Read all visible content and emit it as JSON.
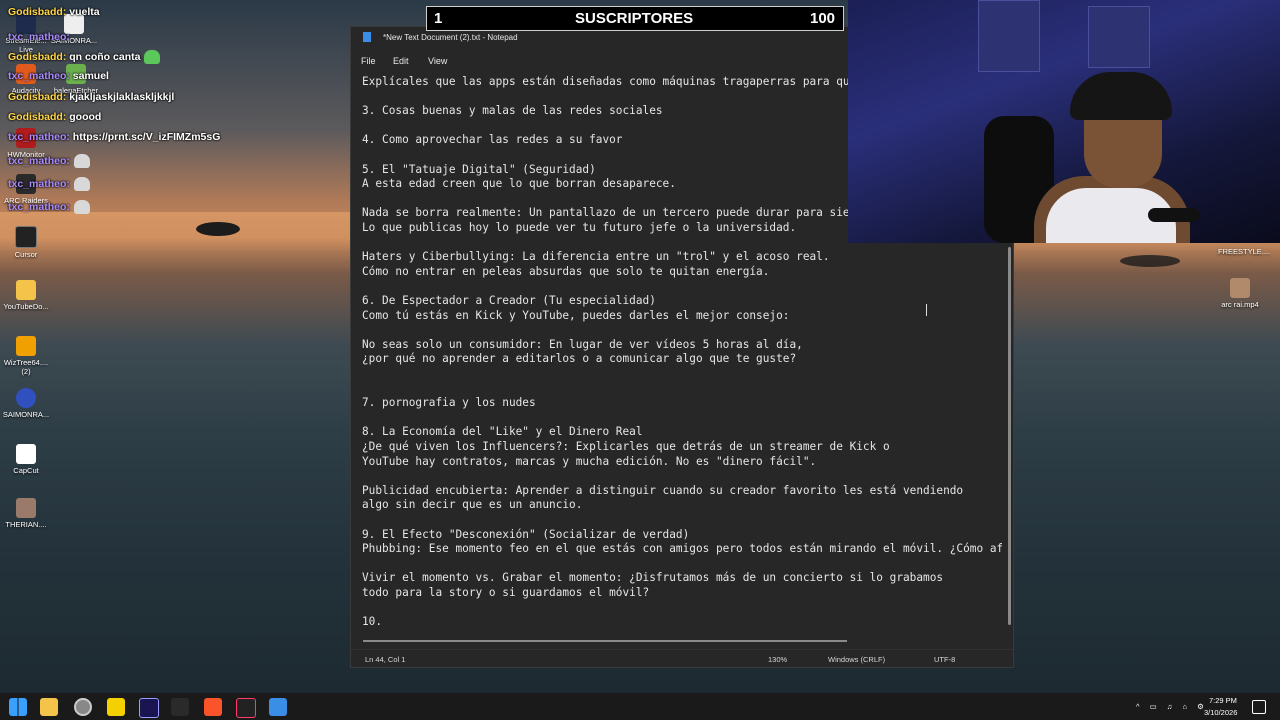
{
  "subscribers": {
    "left": "1",
    "label": "SUSCRIPTORES",
    "right": "100"
  },
  "chat": [
    {
      "user": "Godisbadd:",
      "text": "vuelta",
      "user_color": "#ffd54a"
    },
    {
      "user": "txc_matheo:",
      "text": "",
      "user_color": "#a98bff"
    },
    {
      "user": "Godisbadd:",
      "text": "qn coño canta",
      "user_color": "#ffd54a"
    },
    {
      "user": "txc_matheo:",
      "text": "samuel",
      "user_color": "#a98bff"
    },
    {
      "user": "Godisbadd:",
      "text": "kjakljaskjlaklaskljkkjl",
      "user_color": "#ffd54a"
    },
    {
      "user": "Godisbadd:",
      "text": "goood",
      "user_color": "#ffd54a"
    },
    {
      "user": "txc_matheo:",
      "text": "https://prnt.sc/V_izFIMZm5sG",
      "user_color": "#a98bff"
    },
    {
      "user": "txc_matheo:",
      "text": "",
      "user_color": "#a98bff"
    },
    {
      "user": "txc_matheo:",
      "text": "",
      "user_color": "#a98bff"
    },
    {
      "user": "txc_matheo:",
      "text": "",
      "user_color": "#a98bff"
    }
  ],
  "desktop_icons": [
    {
      "label": "StreamEle... Live"
    },
    {
      "label": "SAIMONRA..."
    },
    {
      "label": "Audacity"
    },
    {
      "label": "balenaEtcher"
    },
    {
      "label": "HWMonitor"
    },
    {
      "label": "ARC Raiders"
    },
    {
      "label": "Cursor"
    },
    {
      "label": "YouTubeDo..."
    },
    {
      "label": "WizTree64.... (2)"
    },
    {
      "label": "SAIMONRA..."
    },
    {
      "label": "CapCut"
    },
    {
      "label": "THERIAN...."
    },
    {
      "label": "arc rai.mp4"
    }
  ],
  "notepad": {
    "title": "*New Text Document (2).txt - Notepad",
    "menu": [
      "File",
      "Edit",
      "View"
    ],
    "lines": [
      "Explícales que las apps están diseñadas como máquinas tragaperras para qu",
      "",
      "3. Cosas buenas y malas de las redes sociales",
      "",
      "4. Como aprovechar las redes a su favor",
      "",
      "5. El \"Tatuaje Digital\" (Seguridad)",
      "A esta edad creen que lo que borran desaparece.",
      "",
      "Nada se borra realmente: Un pantallazo de un tercero puede durar para sie",
      "Lo que publicas hoy lo puede ver tu futuro jefe o la universidad.",
      "",
      "Haters y Ciberbullying: La diferencia entre un \"trol\" y el acoso real.",
      "Cómo no entrar en peleas absurdas que solo te quitan energía.",
      "",
      "6. De Espectador a Creador (Tu especialidad)",
      "Como tú estás en Kick y YouTube, puedes darles el mejor consejo:",
      "",
      "No seas solo un consumidor: En lugar de ver vídeos 5 horas al día,",
      "¿por qué no aprender a editarlos o a comunicar algo que te guste?",
      "",
      "",
      "7. pornografia y los nudes",
      "",
      "8. La Economía del \"Like\" y el Dinero Real",
      "¿De qué viven los Influencers?: Explicarles que detrás de un streamer de Kick o",
      "YouTube hay contratos, marcas y mucha edición. No es \"dinero fácil\".",
      "",
      "Publicidad encubierta: Aprender a distinguir cuando su creador favorito les está vendiendo",
      "algo sin decir que es un anuncio.",
      "",
      "9. El Efecto \"Desconexión\" (Socializar de verdad)",
      "Phubbing: Ese momento feo en el que estás con amigos pero todos están mirando el móvil. ¿Cómo af",
      "",
      "Vivir el momento vs. Grabar el momento: ¿Disfrutamos más de un concierto si lo grabamos",
      "todo para la story o si guardamos el móvil?",
      "",
      "10."
    ],
    "status": {
      "position": "Ln 44, Col 1",
      "zoom": "130%",
      "line_ending": "Windows (CRLF)",
      "encoding": "UTF-8"
    }
  },
  "overlay_label": "FREESTYLE....",
  "taskbar": {
    "apps": [
      "start-icon",
      "search-icon",
      "file-explorer-icon",
      "chrome-icon",
      "notes-icon",
      "premiere-icon",
      "capcut-icon",
      "brave-icon",
      "tiktok-icon",
      "notepad-icon"
    ],
    "time": "7:29 PM",
    "date": "3/10/2026"
  }
}
